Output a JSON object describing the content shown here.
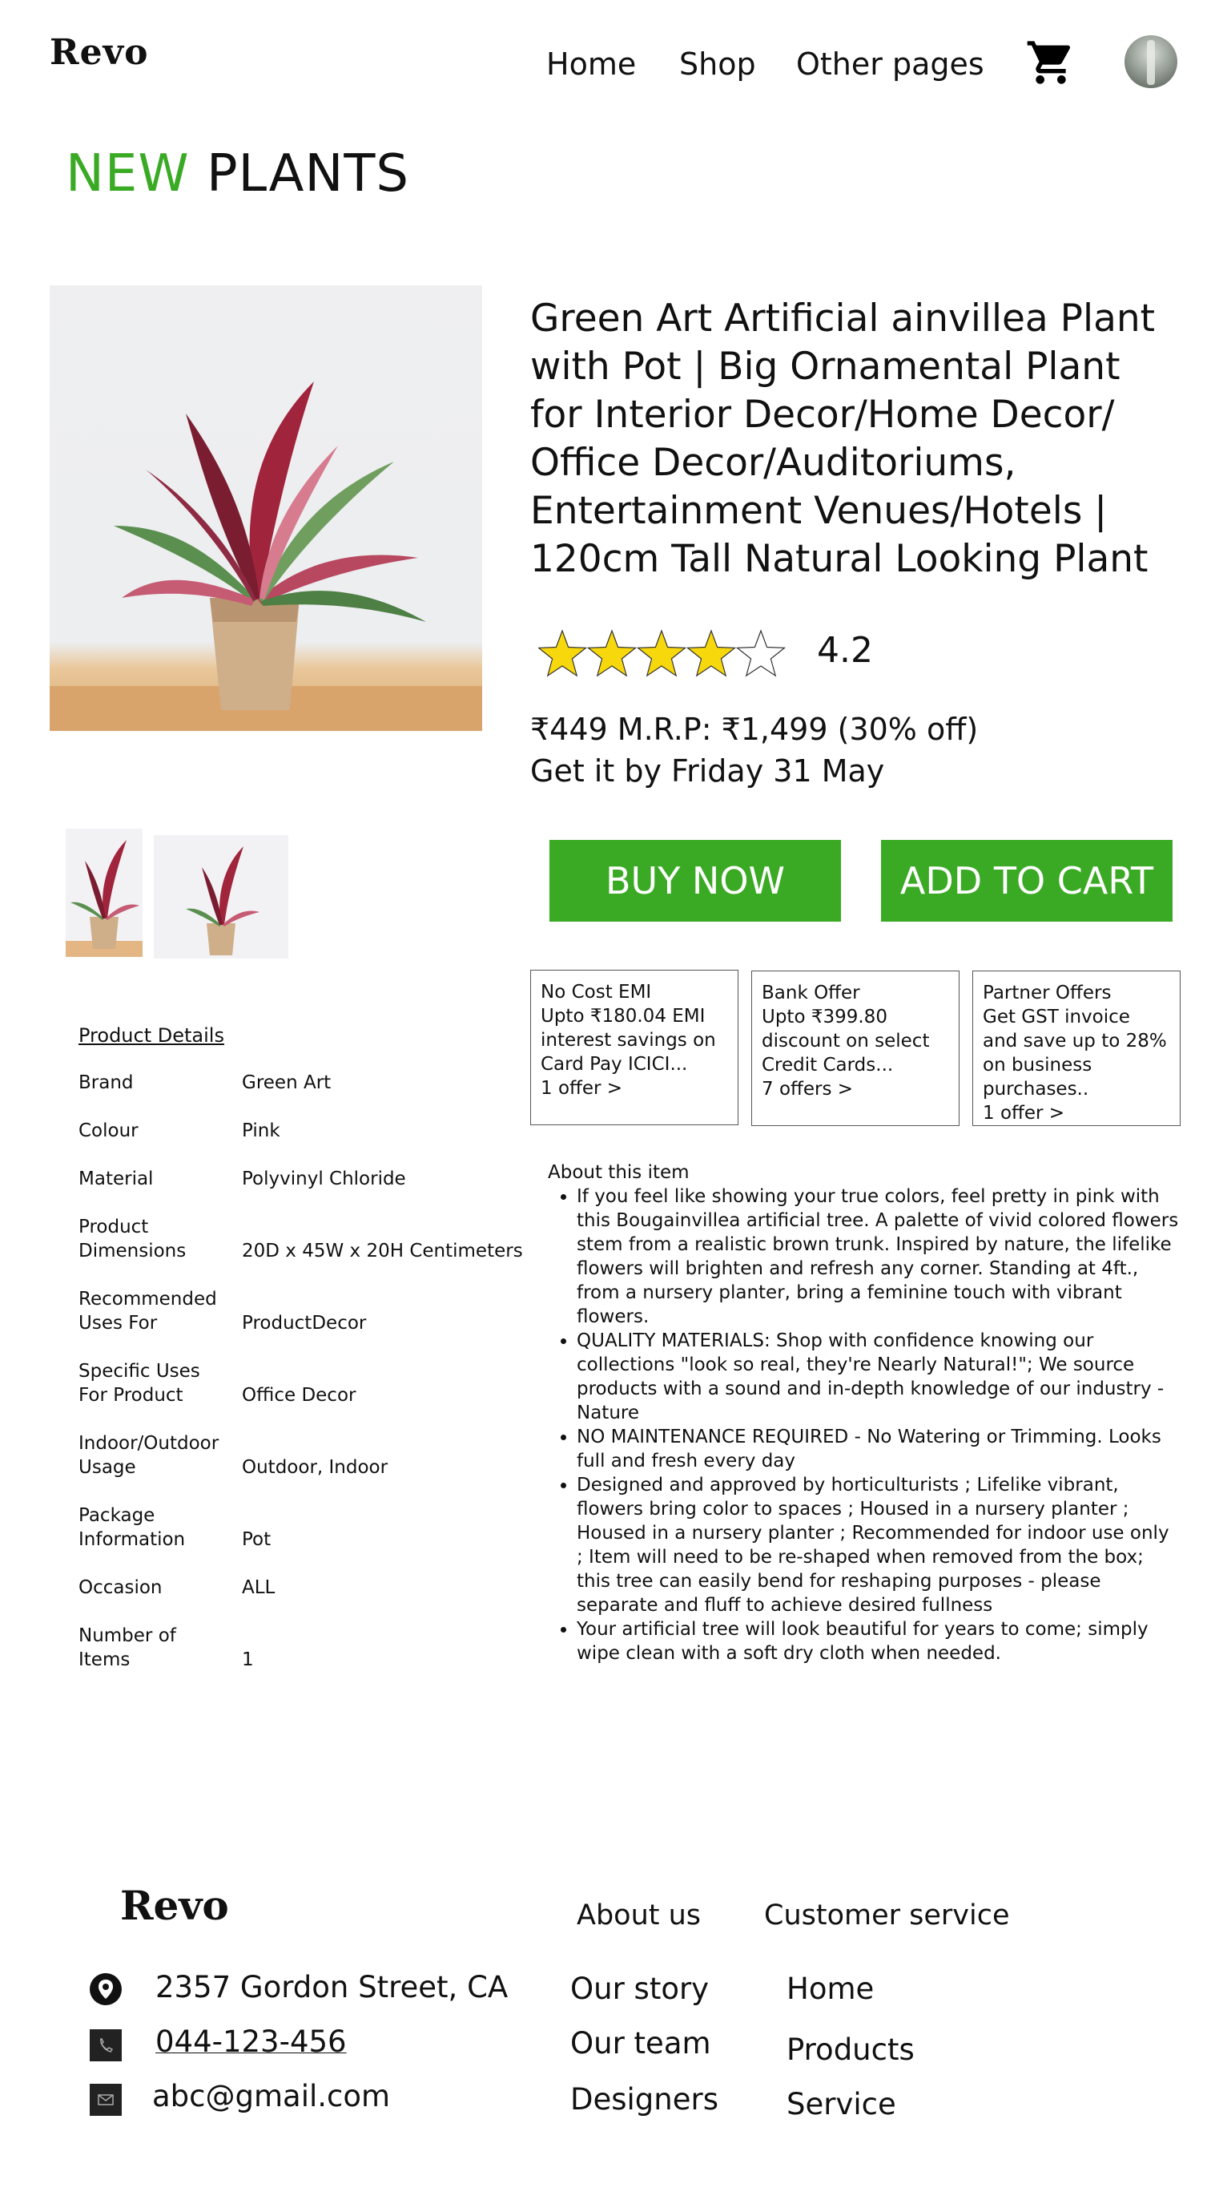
{
  "header": {
    "logo": "Revo",
    "nav": [
      "Home",
      "Shop",
      "Other pages"
    ],
    "cart_icon": "shopping-cart-icon",
    "avatar_icon": "user-avatar"
  },
  "section": {
    "accent": "NEW",
    "title": "PLANTS"
  },
  "product": {
    "title": "Green Art Artificial ainvillea Plant with Pot | Big Ornamental Plant for Interior Decor/Home Decor/ Office Decor/Auditoriums, Entertainment Venues/Hotels | 120cm Tall Natural Looking Plant",
    "rating": "4.2",
    "rating_value": 4.2,
    "rating_max": 5,
    "price_line": "₹449 M.R.P: ₹1,499 (30% off)",
    "delivery": "Get it by Friday 31 May",
    "buy_now": "BUY NOW",
    "add_to_cart": "ADD TO CART"
  },
  "offers": [
    {
      "line1": "No Cost EMI",
      "body": "Upto ₹180.04 EMI interest savings on Card Pay ICICI...",
      "link": "1 offer >"
    },
    {
      "line1": "Bank Offer",
      "body": "Upto ₹399.80 discount on select Credit Cards...",
      "link": "7 offers >"
    },
    {
      "line1": "Partner Offers",
      "body": "Get GST invoice and save up to 28% on business purchases..",
      "link": "1 offer >"
    }
  ],
  "details": {
    "title": "Product Details",
    "rows": [
      {
        "k": "Brand",
        "v": "Green Art"
      },
      {
        "k": "Colour",
        "v": "Pink"
      },
      {
        "k": "Material",
        "v": "Polyvinyl Chloride"
      },
      {
        "k": "Product Dimensions",
        "v": "20D x 45W x 20H Centimeters"
      },
      {
        "k": "Recommended Uses For",
        "v": "ProductDecor"
      },
      {
        "k": "Specific Uses For Product",
        "v": "Office Decor"
      },
      {
        "k": "Indoor/Outdoor Usage",
        "v": "Outdoor, Indoor"
      },
      {
        "k": "Package Information",
        "v": "Pot"
      },
      {
        "k": "Occasion",
        "v": "ALL"
      },
      {
        "k": "Number of Items",
        "v": "1"
      }
    ]
  },
  "about": {
    "title": "About this item",
    "items": [
      "If you feel like showing your true colors, feel pretty in pink with this Bougainvillea artificial tree. A palette of vivid colored flowers stem from a realistic brown trunk. Inspired by nature, the lifelike flowers will brighten and refresh any corner. Standing at 4ft., from a nursery planter, bring a feminine touch with vibrant flowers.",
      "QUALITY MATERIALS: Shop with confidence knowing our collections \"look so real, they're Nearly Natural!\"; We source products with a sound and in-depth knowledge of our industry - Nature",
      "NO MAINTENANCE REQUIRED - No Watering or Trimming. Looks full and fresh every day",
      "Designed and approved by horticulturists ; Lifelike vibrant, flowers bring color to spaces ; Housed in a nursery planter ; Housed in a nursery planter ; Recommended for indoor use only ; Item will need to be re-shaped when removed from the box; this tree can easily bend for reshaping purposes - please separate and fluff to achieve desired fullness",
      "Your artificial tree will look beautiful for years to come; simply wipe clean with a soft dry cloth when needed."
    ]
  },
  "footer": {
    "logo": "Revo",
    "address": "2357 Gordon Street, CA",
    "phone": "044-123-456",
    "email": "abc@gmail.com",
    "about_heading": "About us",
    "about_links": [
      "Our story",
      "Our team",
      "Designers"
    ],
    "service_heading": "Customer service",
    "service_links": [
      "Home",
      "Products",
      "Service"
    ]
  },
  "colors": {
    "accent": "#3aaa24",
    "star": "#f7d80d"
  }
}
